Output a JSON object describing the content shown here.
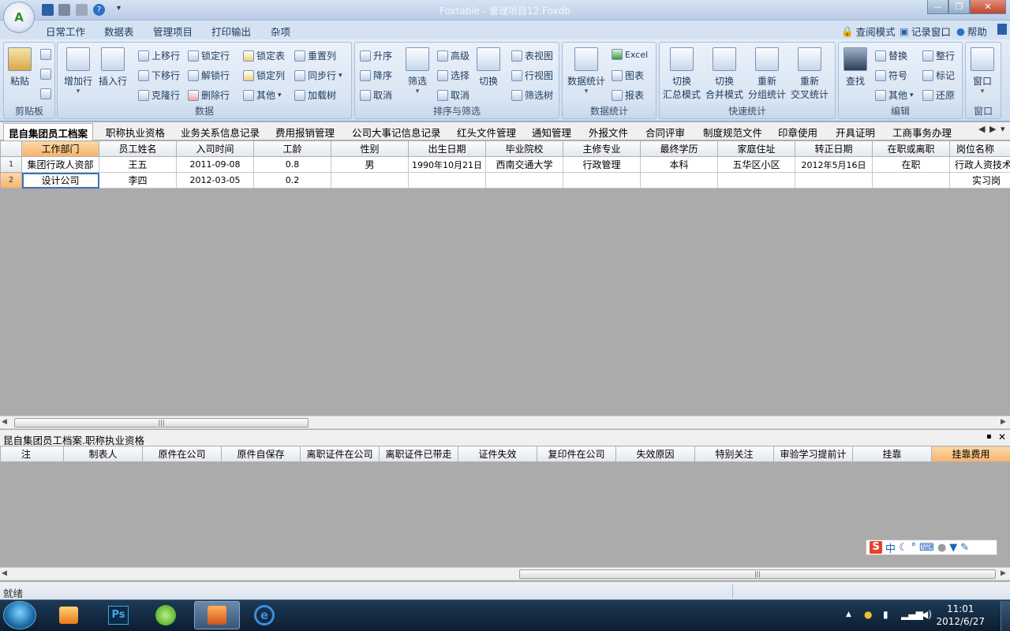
{
  "window": {
    "title": "Foxtable - 管理项目12.Foxdb"
  },
  "menu": {
    "tabs": [
      "日常工作",
      "数据表",
      "管理项目",
      "打印输出",
      "杂项"
    ],
    "right": [
      "查阅模式",
      "记录窗口",
      "帮助"
    ]
  },
  "ribbon": {
    "clipboard": {
      "paste": "粘贴",
      "label": "剪贴板"
    },
    "data": {
      "add_row": "增加行",
      "insert_row": "插入行",
      "move_up": "上移行",
      "move_down": "下移行",
      "clone_row": "克隆行",
      "lock_row": "锁定行",
      "unlock_row": "解锁行",
      "delete_row": "删除行",
      "lock_table": "锁定表",
      "lock_col": "锁定列",
      "other": "其他",
      "reset_col": "重置列",
      "sync_row": "同步行",
      "load_tree": "加载树",
      "label": "数据"
    },
    "sort_filter": {
      "asc": "升序",
      "desc": "降序",
      "cancel": "取消",
      "filter": "筛选",
      "advanced": "高级",
      "select": "选择",
      "cancel2": "取消",
      "switch": "切换",
      "table_view": "表视图",
      "row_view": "行视图",
      "filter_tree": "筛选树",
      "label": "排序与筛选"
    },
    "stats": {
      "data_stats": "数据统计",
      "excel": "Excel",
      "chart": "图表",
      "report": "报表",
      "label": "数据统计"
    },
    "quick_stats": {
      "b1": [
        "切换",
        "汇总模式"
      ],
      "b2": [
        "切换",
        "合并模式"
      ],
      "b3": [
        "重新",
        "分组统计"
      ],
      "b4": [
        "重新",
        "交叉统计"
      ],
      "label": "快速统计"
    },
    "edit": {
      "find": "查找",
      "replace": "替换",
      "symbol": "符号",
      "other": "其他",
      "tidy_row": "整行",
      "mark": "标记",
      "restore": "还原",
      "label": "编辑"
    },
    "window": {
      "window": "窗口",
      "label": "窗口"
    }
  },
  "sheet_tabs": [
    "昆自集团员工档案",
    "职称执业资格",
    "业务关系信息记录",
    "费用报销管理",
    "公司大事记信息记录",
    "红头文件管理",
    "通知管理",
    "外报文件",
    "合同评审",
    "制度规范文件",
    "印章使用",
    "开具证明",
    "工商事务办理"
  ],
  "grid": {
    "columns": [
      "工作部门",
      "员工姓名",
      "入司时间",
      "工龄",
      "性别",
      "出生日期",
      "毕业院校",
      "主修专业",
      "最终学历",
      "家庭住址",
      "转正日期",
      "在职或离职",
      "岗位名称"
    ],
    "rows": [
      [
        "1",
        "集团行政人资部",
        "王五",
        "2011-09-08",
        "0.8",
        "男",
        "1990年10月21日",
        "西南交通大学",
        "行政管理",
        "本科",
        "五华区小区",
        "2012年5月16日",
        "在职",
        "行政人资技术"
      ],
      [
        "2",
        "设计公司",
        "李四",
        "2012-03-05",
        "0.2",
        "",
        "",
        "",
        "",
        "",
        "",
        "",
        "",
        "实习岗"
      ]
    ]
  },
  "subpane": {
    "title": "昆自集团员工档案.职称执业资格",
    "columns": [
      "注",
      "制表人",
      "原件在公司",
      "原件自保存",
      "离职证件在公司",
      "离职证件已带走",
      "证件失效",
      "复印件在公司",
      "失效原因",
      "特别关注",
      "审验学习提前计",
      "挂靠",
      "挂靠费用"
    ]
  },
  "ime": {
    "lang": "中"
  },
  "status": {
    "text": "就绪"
  },
  "clock": {
    "time": "11:01",
    "date": "2012/6/27"
  }
}
